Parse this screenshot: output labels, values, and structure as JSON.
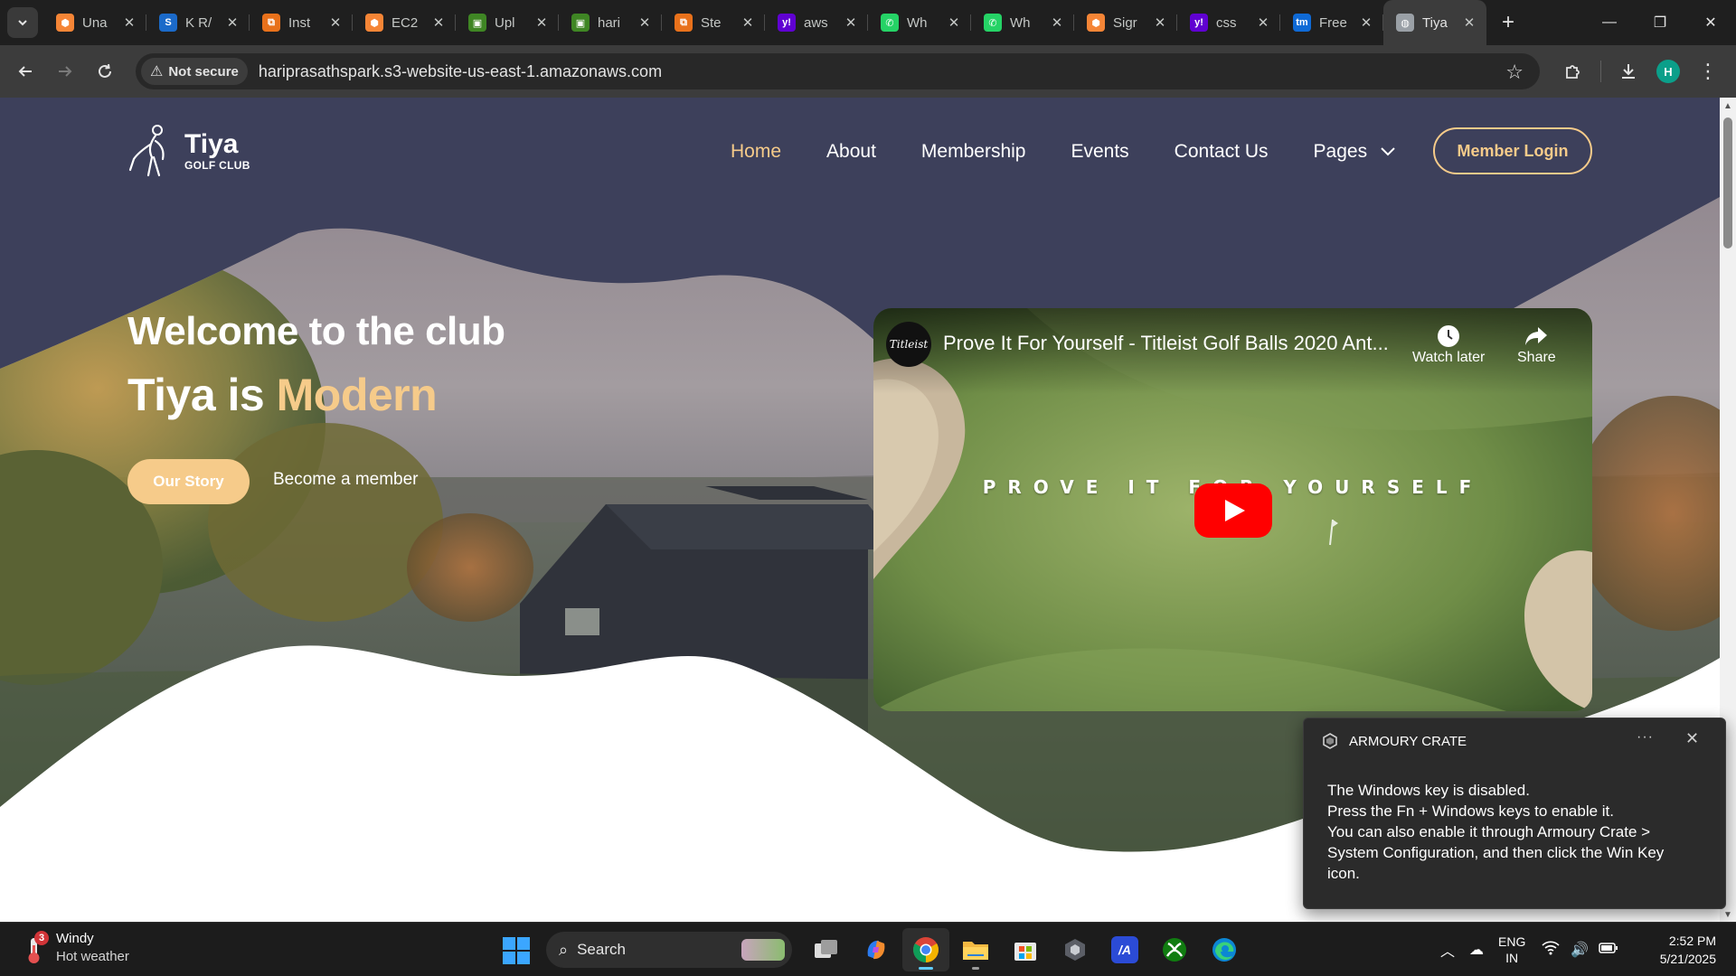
{
  "browser": {
    "tab_search_icon": "chevron-down-icon",
    "tabs": [
      {
        "title": "Una",
        "icon": "aws-cube-icon",
        "color": "#f58536",
        "active": false
      },
      {
        "title": "K R/",
        "icon": "s-logo-icon",
        "color": "#1b6ac9",
        "active": false
      },
      {
        "title": "Inst",
        "icon": "aws-service-icon",
        "color": "#e8711b",
        "active": false
      },
      {
        "title": "EC2",
        "icon": "aws-cube-icon",
        "color": "#f58536",
        "active": false
      },
      {
        "title": "Upl",
        "icon": "s3-bucket-icon",
        "color": "#3f8624",
        "active": false
      },
      {
        "title": "hari",
        "icon": "s3-bucket-icon",
        "color": "#3f8624",
        "active": false
      },
      {
        "title": "Ste",
        "icon": "aws-service-icon",
        "color": "#e8711b",
        "active": false
      },
      {
        "title": "aws",
        "icon": "yahoo-icon",
        "color": "#6001d2",
        "active": false
      },
      {
        "title": "Wh",
        "icon": "whatsapp-icon",
        "color": "#25d366",
        "active": false
      },
      {
        "title": "Wh",
        "icon": "whatsapp-icon",
        "color": "#25d366",
        "active": false
      },
      {
        "title": "Sigr",
        "icon": "aws-cube-icon",
        "color": "#f58536",
        "active": false
      },
      {
        "title": "css",
        "icon": "yahoo-icon",
        "color": "#6001d2",
        "active": false
      },
      {
        "title": "Free",
        "icon": "tm-icon",
        "color": "#0f6ad6",
        "active": false
      },
      {
        "title": "Tiya",
        "icon": "globe-icon",
        "color": "#9aa0a6",
        "active": true
      }
    ],
    "new_tab": "+",
    "window_controls": {
      "minimize": "—",
      "restore": "❐",
      "close": "✕"
    },
    "address_bar": {
      "security_label": "Not secure",
      "url": "hariprasathspark.s3-website-us-east-1.amazonaws.com"
    },
    "profile_initial": "H"
  },
  "site": {
    "logo": {
      "name": "Tiya",
      "tagline": "GOLF CLUB"
    },
    "nav": [
      {
        "label": "Home",
        "active": true
      },
      {
        "label": "About",
        "active": false
      },
      {
        "label": "Membership",
        "active": false
      },
      {
        "label": "Events",
        "active": false
      },
      {
        "label": "Contact Us",
        "active": false
      },
      {
        "label": "Pages",
        "active": false
      }
    ],
    "login_label": "Member Login",
    "hero": {
      "title": "Welcome to the club",
      "subtitle_prefix": "Tiya is ",
      "subtitle_accent": "Modern",
      "primary_cta": "Our Story",
      "secondary_cta": "Become a member"
    },
    "colors": {
      "accent": "#f6cb8a",
      "header_bg": "#3d405b"
    },
    "video": {
      "channel": "Titleist",
      "title": "Prove It For Yourself - Titleist Golf Balls 2020 Ant...",
      "watch_later": "Watch later",
      "share": "Share",
      "overlay_text": "PROVE IT FOR YOURSELF"
    }
  },
  "notification": {
    "app": "ARMOURY CRATE",
    "more": "···",
    "lines": [
      "The Windows key is disabled.",
      "Press the Fn + Windows keys to enable it.",
      "You can also enable it through Armoury Crate >",
      "System Configuration, and then click the Win Key",
      "icon."
    ]
  },
  "taskbar": {
    "weather": {
      "badge": "3",
      "title": "Windy",
      "subtitle": "Hot weather"
    },
    "search_label": "Search",
    "apps": [
      {
        "name": "task-view",
        "active": false
      },
      {
        "name": "copilot",
        "active": false
      },
      {
        "name": "chrome",
        "active": true
      },
      {
        "name": "file-explorer",
        "active": false
      },
      {
        "name": "microsoft-store",
        "active": false
      },
      {
        "name": "armoury-crate",
        "active": false
      },
      {
        "name": "myasus",
        "active": false
      },
      {
        "name": "xbox",
        "active": false
      },
      {
        "name": "edge",
        "active": false
      }
    ],
    "language": {
      "line1": "ENG",
      "line2": "IN"
    },
    "time": "2:52 PM",
    "date": "5/21/2025"
  }
}
